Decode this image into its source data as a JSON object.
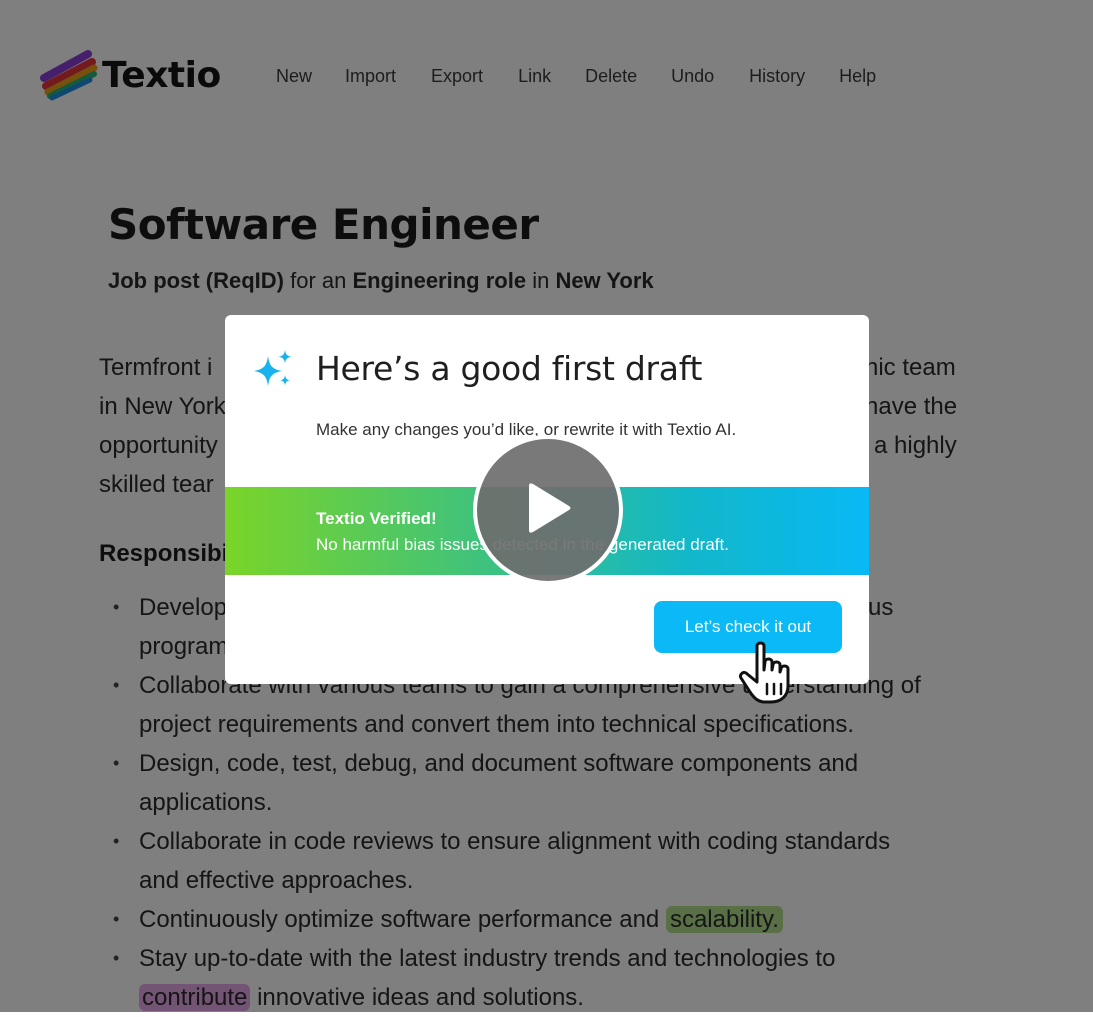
{
  "header": {
    "logo_text": "Textio",
    "nav": [
      "New",
      "Import",
      "Export",
      "Link",
      "Delete",
      "Undo",
      "History",
      "Help"
    ]
  },
  "job": {
    "title": "Software Engineer",
    "subtitle": {
      "part1": "Job post (ReqID)",
      "part2": " for an ",
      "part3": "Engineering role",
      "part4": " in ",
      "part5": "New York"
    }
  },
  "intro_visible_lines": [
    {
      "left": "Termfront i",
      "right": "nic team"
    },
    {
      "left": "in New York",
      "right": "have the"
    },
    {
      "left": "opportunity",
      "right": "a highly"
    },
    {
      "left": "skilled tear",
      "right": ""
    }
  ],
  "responsibilities": {
    "heading": "Responsibi",
    "items": [
      {
        "line1": "Develop",
        "line1_right": "us",
        "line2": "program"
      },
      {
        "line1": "Collaborate with various teams to gain a comprehensive understanding of",
        "line2": "project requirements and convert them into technical specifications."
      },
      {
        "line1": "Design, code, test, debug, and document software components and",
        "line2": "applications."
      },
      {
        "line1": "Collaborate in code reviews to ensure alignment with coding standards",
        "line2": "and effective approaches."
      },
      {
        "line1_prefix": "Continuously optimize software performance and ",
        "highlight": "scalability."
      },
      {
        "line1": "Stay up-to-date with the latest industry trends and technologies to",
        "highlight": "contribute",
        "line2_suffix": " innovative ideas and solutions."
      }
    ]
  },
  "modal": {
    "title": "Here’s a good first draft",
    "description": "Make any changes you’d like, or rewrite it with Textio AI.",
    "banner_title": "Textio Verified!",
    "banner_text": "No harmful bias issues detected in the generated draft.",
    "cta_label": "Let’s check it out"
  },
  "icons": {
    "sparkle": "sparkle-icon",
    "play": "play-icon",
    "cursor": "hand-pointer-icon"
  },
  "colors": {
    "accent": "#0ab9f6",
    "banner_start": "#7bd428",
    "banner_end": "#08b9f5",
    "highlight_green": "#b3e08e",
    "highlight_purple": "#e7a8e8"
  }
}
